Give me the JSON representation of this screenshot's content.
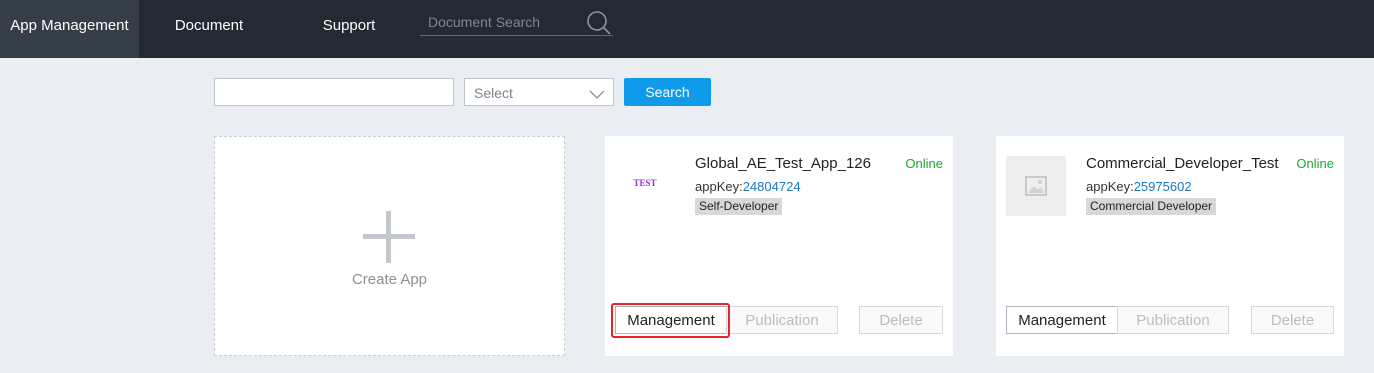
{
  "nav": {
    "items": [
      {
        "label": "App Management",
        "active": true
      },
      {
        "label": "Document",
        "active": false
      },
      {
        "label": "Support",
        "active": false
      }
    ],
    "search_placeholder": "Document Search",
    "search_icon": "magnifier-icon"
  },
  "filter": {
    "input_value": "",
    "select_placeholder": "Select",
    "search_label": "Search"
  },
  "create_card": {
    "label": "Create App"
  },
  "apps": [
    {
      "name": "Global_AE_Test_App_126",
      "status": "Online",
      "appkey_label": "appKey:",
      "appkey": "24804724",
      "type": "Self-Developer",
      "logo_text": "TEST",
      "buttons": {
        "manage": "Management",
        "publication": "Publication",
        "delete": "Delete"
      }
    },
    {
      "name": "Commercial_Developer_Test",
      "status": "Online",
      "appkey_label": "appKey:",
      "appkey": "25975602",
      "type": "Commercial Developer",
      "logo_text": "",
      "buttons": {
        "manage": "Management",
        "publication": "Publication",
        "delete": "Delete"
      }
    }
  ],
  "colors": {
    "nav_bg": "#232a33",
    "nav_active": "#353d47",
    "primary": "#109bea",
    "online": "#19a834",
    "appkey_link": "#1a78c2",
    "highlight": "#e5242e"
  }
}
